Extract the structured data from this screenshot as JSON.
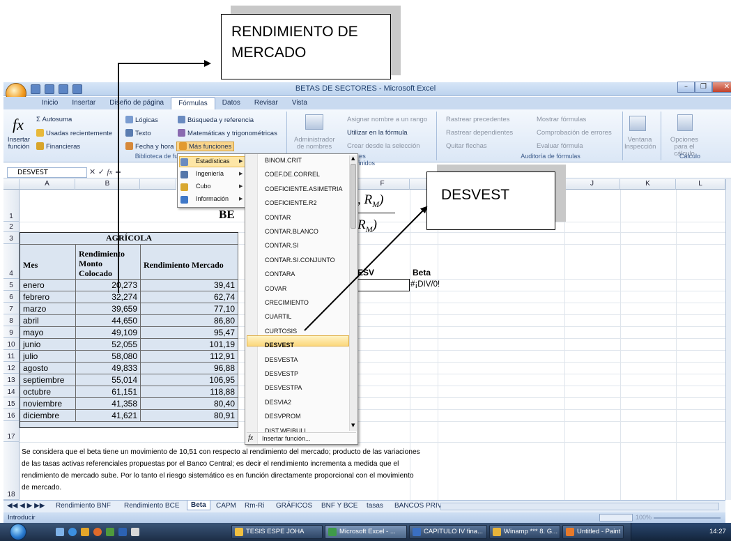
{
  "callouts": {
    "mercado": "RENDIMIENTO DE MERCADO",
    "desvest": "DESVEST"
  },
  "window": {
    "title": "BETAS DE SECTORES - Microsoft Excel",
    "controls": [
      "–",
      "❐",
      "✕"
    ]
  },
  "tabs": [
    "Inicio",
    "Insertar",
    "Diseño de página",
    "Fórmulas",
    "Datos",
    "Revisar",
    "Vista"
  ],
  "active_tab": "Fórmulas",
  "ribbon": {
    "insert_function": "Insertar función",
    "autosuma": "Σ Autosuma",
    "usadas": "Usadas recientemente",
    "financieras": "Financieras",
    "logicas": "Lógicas",
    "texto": "Texto",
    "fecha": "Fecha y hora",
    "busqueda": "Búsqueda y referencia",
    "matematicas": "Matemáticas y trigonométricas",
    "mas_funciones": "Más funciones",
    "group_biblioteca": "Biblioteca de funciones",
    "administrador": "Administrador de nombres",
    "asignar": "Asignar nombre a un rango",
    "utilizar": "Utilizar en la fórmula",
    "crear": "Crear desde la selección",
    "group_nombres": "es definidos",
    "rastrear_prec": "Rastrear precedentes",
    "rastrear_dep": "Rastrear dependientes",
    "quitar": "Quitar flechas",
    "mostrar": "Mostrar fórmulas",
    "comprobacion": "Comprobación de errores",
    "evaluar": "Evaluar fórmula",
    "group_auditoria": "Auditoría de fórmulas",
    "ventana": "Ventana Inspección",
    "opciones": "Opciones para el cálculo",
    "group_calculo": "Cálculo"
  },
  "formula_bar": {
    "name": "DESVEST",
    "content": "="
  },
  "columns": [
    "A",
    "B",
    "F",
    "J",
    "K",
    "L"
  ],
  "rows": [
    "1",
    "2",
    "3",
    "4",
    "5",
    "6",
    "7",
    "8",
    "9",
    "10",
    "11",
    "12",
    "13",
    "14",
    "15",
    "16",
    "17",
    "18"
  ],
  "sheet": {
    "title_frag": "BE",
    "formula_frag1": ", R",
    "formula_sub": "M",
    "formula_frag2": "R",
    "table_title": "AGRÍCOLA",
    "headers": [
      "Mes",
      "Rendimiento Monto Colocado",
      "Rendimiento Mercado"
    ],
    "rows": [
      [
        "enero",
        "20,273",
        "39,41"
      ],
      [
        "febrero",
        "32,274",
        "62,74"
      ],
      [
        "marzo",
        "39,659",
        "77,10"
      ],
      [
        "abril",
        "44,650",
        "86,80"
      ],
      [
        "mayo",
        "49,109",
        "95,47"
      ],
      [
        "junio",
        "52,055",
        "101,19"
      ],
      [
        "julio",
        "58,080",
        "112,91"
      ],
      [
        "agosto",
        "49,833",
        "96,88"
      ],
      [
        "septiembre",
        "55,014",
        "106,95"
      ],
      [
        "octubre",
        "61,151",
        "118,88"
      ],
      [
        "noviembre",
        "41,358",
        "80,40"
      ],
      [
        "diciembre",
        "41,621",
        "80,91"
      ]
    ],
    "desv_header": "ESV",
    "beta_header": "Beta",
    "beta_value": "#¡DIV/0!",
    "note": "Se considera que el beta tiene un movimiento de 10,51 con respecto al rendimiento del mercado; producto de las variaciones de las tasas activas referenciales propuestas por el Banco Central; es decir el rendimiento incrementa  a medida que el rendimiento de mercado sube. Por lo tanto el riesgo sistemático es en función directamente proporcional con el movimiento de mercado."
  },
  "more_functions_menu": [
    "Estadísticas",
    "Ingeniería",
    "Cubo",
    "Información"
  ],
  "stat_menu": [
    "BINOM.CRIT",
    "COEF.DE.CORREL",
    "COEFICIENTE.ASIMETRIA",
    "COEFICIENTE.R2",
    "CONTAR",
    "CONTAR.BLANCO",
    "CONTAR.SI",
    "CONTAR.SI.CONJUNTO",
    "CONTARA",
    "COVAR",
    "CRECIMIENTO",
    "CUARTIL",
    "CURTOSIS",
    "DESVEST",
    "DESVESTA",
    "DESVESTP",
    "DESVESTPA",
    "DESVIA2",
    "DESVPROM",
    "DIST.WEIBULL"
  ],
  "stat_selected": "DESVEST",
  "insert_function_item": "Insertar función...",
  "sheet_tabs": [
    "Rendimiento BNF",
    "Rendimiento BCE",
    "Beta",
    "CAPM",
    "Rm-Ri",
    "GRÁFICOS",
    "BNF Y BCE",
    "tasas",
    "BANCOS PRIV"
  ],
  "active_sheet": "Beta",
  "status": "Introducir",
  "zoom": "100%",
  "taskbar": {
    "items": [
      "TESIS ESPE JOHA",
      "Microsoft Excel - ...",
      "CAPITULO IV fina...",
      "Winamp *** 8. G...",
      "Untitled - Paint"
    ],
    "clock": "14:27"
  }
}
